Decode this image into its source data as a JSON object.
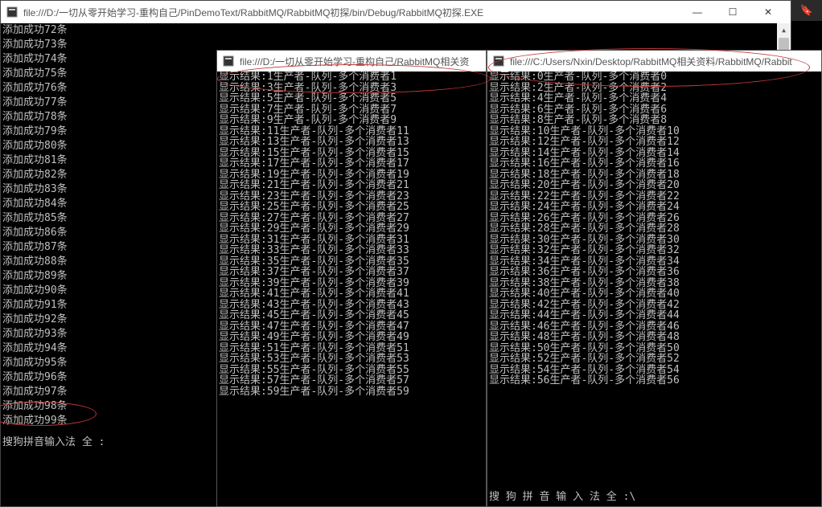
{
  "main_window": {
    "title": "file:///D:/一切从零开始学习-重构自己/PinDemoText/RabbitMQ/RabbitMQ初探/bin/Debug/RabbitMQ初探.EXE",
    "controls": {
      "min": "—",
      "max": "☐",
      "close": "✕"
    },
    "lines": [
      "添加成功72条",
      "添加成功73条",
      "添加成功74条",
      "添加成功75条",
      "添加成功76条",
      "添加成功77条",
      "添加成功78条",
      "添加成功79条",
      "添加成功80条",
      "添加成功81条",
      "添加成功82条",
      "添加成功83条",
      "添加成功84条",
      "添加成功85条",
      "添加成功86条",
      "添加成功87条",
      "添加成功88条",
      "添加成功89条",
      "添加成功90条",
      "添加成功91条",
      "添加成功92条",
      "添加成功93条",
      "添加成功94条",
      "添加成功95条",
      "添加成功96条",
      "添加成功97条",
      "添加成功98条",
      "添加成功99条"
    ],
    "ime": "搜狗拼音输入法 全 :"
  },
  "mid_window": {
    "title": "file:///D:/一切从零开始学习-重构自己/RabbitMQ相关资",
    "lines": [
      "显示结果:1生产者-队列-多个消费者1",
      "显示结果:3生产者-队列-多个消费者3",
      "显示结果:5生产者-队列-多个消费者5",
      "显示结果:7生产者-队列-多个消费者7",
      "显示结果:9生产者-队列-多个消费者9",
      "显示结果:11生产者-队列-多个消费者11",
      "显示结果:13生产者-队列-多个消费者13",
      "显示结果:15生产者-队列-多个消费者15",
      "显示结果:17生产者-队列-多个消费者17",
      "显示结果:19生产者-队列-多个消费者19",
      "显示结果:21生产者-队列-多个消费者21",
      "显示结果:23生产者-队列-多个消费者23",
      "显示结果:25生产者-队列-多个消费者25",
      "显示结果:27生产者-队列-多个消费者27",
      "显示结果:29生产者-队列-多个消费者29",
      "显示结果:31生产者-队列-多个消费者31",
      "显示结果:33生产者-队列-多个消费者33",
      "显示结果:35生产者-队列-多个消费者35",
      "显示结果:37生产者-队列-多个消费者37",
      "显示结果:39生产者-队列-多个消费者39",
      "显示结果:41生产者-队列-多个消费者41",
      "显示结果:43生产者-队列-多个消费者43",
      "显示结果:45生产者-队列-多个消费者45",
      "显示结果:47生产者-队列-多个消费者47",
      "显示结果:49生产者-队列-多个消费者49",
      "显示结果:51生产者-队列-多个消费者51",
      "显示结果:53生产者-队列-多个消费者53",
      "显示结果:55生产者-队列-多个消费者55",
      "显示结果:57生产者-队列-多个消费者57",
      "显示结果:59生产者-队列-多个消费者59"
    ]
  },
  "right_window": {
    "title": "file:///C:/Users/Nxin/Desktop/RabbitMQ相关资料/RabbitMQ/Rabbit",
    "lines": [
      "显示结果:0生产者-队列-多个消费者0",
      "显示结果:2生产者-队列-多个消费者2",
      "显示结果:4生产者-队列-多个消费者4",
      "显示结果:6生产者-队列-多个消费者6",
      "显示结果:8生产者-队列-多个消费者8",
      "显示结果:10生产者-队列-多个消费者10",
      "显示结果:12生产者-队列-多个消费者12",
      "显示结果:14生产者-队列-多个消费者14",
      "显示结果:16生产者-队列-多个消费者16",
      "显示结果:18生产者-队列-多个消费者18",
      "显示结果:20生产者-队列-多个消费者20",
      "显示结果:22生产者-队列-多个消费者22",
      "显示结果:24生产者-队列-多个消费者24",
      "显示结果:26生产者-队列-多个消费者26",
      "显示结果:28生产者-队列-多个消费者28",
      "显示结果:30生产者-队列-多个消费者30",
      "显示结果:32生产者-队列-多个消费者32",
      "显示结果:34生产者-队列-多个消费者34",
      "显示结果:36生产者-队列-多个消费者36",
      "显示结果:38生产者-队列-多个消费者38",
      "显示结果:40生产者-队列-多个消费者40",
      "显示结果:42生产者-队列-多个消费者42",
      "显示结果:44生产者-队列-多个消费者44",
      "显示结果:46生产者-队列-多个消费者46",
      "显示结果:48生产者-队列-多个消费者48",
      "显示结果:50生产者-队列-多个消费者50",
      "显示结果:52生产者-队列-多个消费者52",
      "显示结果:54生产者-队列-多个消费者54",
      "显示结果:56生产者-队列-多个消费者56"
    ],
    "ime": "搜 狗 拼 音 输 入 法   全  :\\"
  },
  "toolbar": {
    "bookmark": "🔖"
  }
}
